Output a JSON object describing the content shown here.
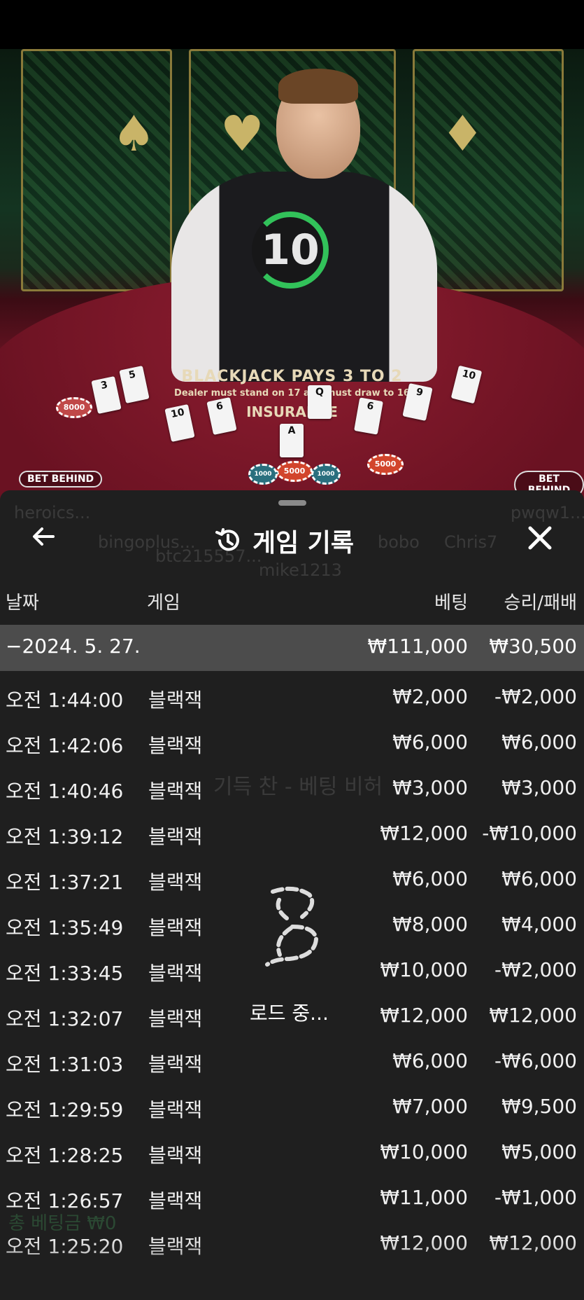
{
  "stage": {
    "timer": "10",
    "table_text_1": "BLACKJACK PAYS 3 TO 2",
    "table_text_2": "Dealer must stand on 17 and must draw to 16",
    "table_text_3": "INSURANCE",
    "bet_behind_left": "BET BEHIND",
    "bet_behind_right": "BET BEHIND",
    "chips": [
      "8000",
      "5000",
      "1000",
      "1000",
      "5000"
    ],
    "players": [
      "heroics...",
      "bingoplus...",
      "btc215557...",
      "mike1213",
      "bobo",
      "Chris7",
      "pwqw1..."
    ]
  },
  "sheet": {
    "title": "게임 기록",
    "columns": {
      "date": "날짜",
      "game": "게임",
      "bet": "베팅",
      "result": "승리/패배"
    },
    "date_group": {
      "date": "−2024. 5. 27.",
      "total_bet": "₩111,000",
      "total_result": "₩30,500"
    },
    "rows": [
      {
        "time": "오전 1:44:00",
        "game": "블랙잭",
        "bet": "₩2,000",
        "result": "-₩2,000"
      },
      {
        "time": "오전 1:42:06",
        "game": "블랙잭",
        "bet": "₩6,000",
        "result": "₩6,000"
      },
      {
        "time": "오전 1:40:46",
        "game": "블랙잭",
        "bet": "₩3,000",
        "result": "₩3,000"
      },
      {
        "time": "오전 1:39:12",
        "game": "블랙잭",
        "bet": "₩12,000",
        "result": "-₩10,000"
      },
      {
        "time": "오전 1:37:21",
        "game": "블랙잭",
        "bet": "₩6,000",
        "result": "₩6,000"
      },
      {
        "time": "오전 1:35:49",
        "game": "블랙잭",
        "bet": "₩8,000",
        "result": "₩4,000"
      },
      {
        "time": "오전 1:33:45",
        "game": "블랙잭",
        "bet": "₩10,000",
        "result": "-₩2,000"
      },
      {
        "time": "오전 1:32:07",
        "game": "블랙잭",
        "bet": "₩12,000",
        "result": "₩12,000"
      },
      {
        "time": "오전 1:31:03",
        "game": "블랙잭",
        "bet": "₩6,000",
        "result": "-₩6,000"
      },
      {
        "time": "오전 1:29:59",
        "game": "블랙잭",
        "bet": "₩7,000",
        "result": "₩9,500"
      },
      {
        "time": "오전 1:28:25",
        "game": "블랙잭",
        "bet": "₩10,000",
        "result": "₩5,000"
      },
      {
        "time": "오전 1:26:57",
        "game": "블랙잭",
        "bet": "₩11,000",
        "result": "-₩1,000"
      },
      {
        "time": "오전 1:25:20",
        "game": "블랙잭",
        "bet": "₩12,000",
        "result": "₩12,000"
      }
    ],
    "loading_text": "로드 중...",
    "ghost_text": "기득 찬 - 베팅 비허",
    "ghost_total_label": "총 베팅금 ₩0"
  },
  "colors": {
    "sheet_bg": "#1f1f1f",
    "date_row_bg": "#4c4c4c",
    "timer_green": "#32c25a",
    "felt": "#7a1527"
  }
}
